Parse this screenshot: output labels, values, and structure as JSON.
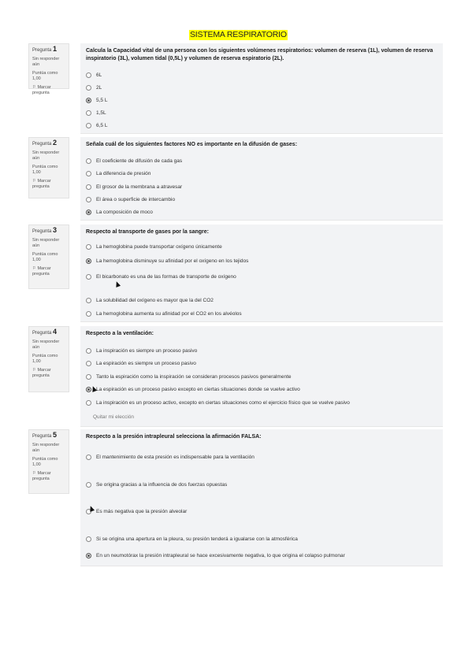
{
  "page_title": "SISTEMA RESPIRATORIO",
  "questions": [
    {
      "label": "Pregunta",
      "number": "1",
      "status": "Sin responder aún",
      "score": "Puntúa como 1,00",
      "flag": "Marcar pregunta",
      "text": "Calcula la Capacidad vital de una persona con los siguientes volúmenes respiratorios: volumen de reserva (1L), volumen de reserva inspiratorio (3L), volumen tidal (0,5L) y volumen de reserva espiratorio (2L).",
      "options": [
        "6L",
        "2L",
        "5,5 L",
        "1,5L",
        "6,5 L"
      ]
    },
    {
      "label": "Pregunta",
      "number": "2",
      "status": "Sin responder aún",
      "score": "Puntúa como 1,00",
      "flag": "Marcar pregunta",
      "text": "Señala cuál de los siguientes factores NO es importante en la difusión de gases:",
      "options": [
        "El coeficiente de difusión de cada gas",
        "La diferencia de presión",
        "El grosor de la membrana a atravesar",
        "El área o superficie de intercambio",
        "La composición de moco"
      ]
    },
    {
      "label": "Pregunta",
      "number": "3",
      "status": "Sin responder aún",
      "score": "Puntúa como 1,00",
      "flag": "Marcar pregunta",
      "text": "Respecto al transporte de gases por la sangre:",
      "options": [
        "La hemoglobina puede transportar oxígeno únicamente",
        "La hemoglobina disminuye su afinidad por el oxígeno en los tejidos",
        "El bicarbonato es una de las formas de transporte de oxígeno",
        "La solubilidad del oxígeno es mayor que la del CO2",
        "La hemoglobina aumenta su afinidad por el CO2 en los alvéolos"
      ]
    },
    {
      "label": "Pregunta",
      "number": "4",
      "status": "Sin responder aún",
      "score": "Puntúa como 1,00",
      "flag": "Marcar pregunta",
      "text": "Respecto a la ventilación:",
      "options": [
        "La inspiración es siempre un proceso pasivo",
        "La espiración es siempre un proceso pasivo",
        "Tanto la espiración como la inspiración se consideran procesos pasivos generalmente",
        "La espiración es un proceso pasivo excepto en ciertas situaciones donde se vuelve activo",
        "La inspiración es un proceso activo, excepto en ciertas situaciones como el ejercicio físico que se vuelve pasivo"
      ],
      "clear_choice": "Quitar mi elección"
    },
    {
      "label": "Pregunta",
      "number": "5",
      "status": "Sin responder aún",
      "score": "Puntúa como 1,00",
      "flag": "Marcar pregunta",
      "text": "Respecto a la presión intrapleural selecciona la afirmación FALSA:",
      "options": [
        "El mantenimiento de esta presión es indispensable para la ventilación",
        "Se origina gracias a la influencia de dos fuerzas opuestas",
        "Es más negativa que la presión alveolar",
        "Si se origina una apertura en la pleura, su presión tenderá a igualarse con la atmosférica",
        "En un neumotórax la presión intrapleural se hace excesivamente negativa, lo que origina el colapso pulmonar"
      ]
    }
  ]
}
